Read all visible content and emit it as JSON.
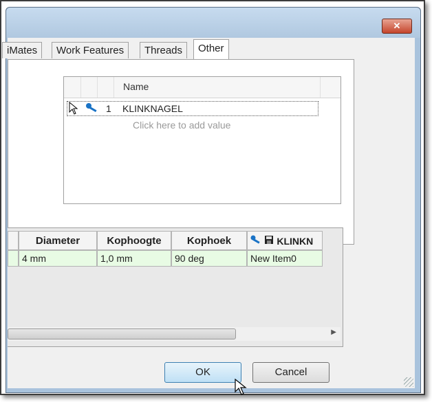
{
  "window": {
    "close_glyph": "✕"
  },
  "tabs": [
    {
      "label": "iMates",
      "active": false
    },
    {
      "label": "Work Features",
      "active": false
    },
    {
      "label": "Threads",
      "active": false
    },
    {
      "label": "Other",
      "active": true
    }
  ],
  "list": {
    "column_header": "Name",
    "rows": [
      {
        "number": "1",
        "name": "KLINKNAGEL",
        "icon": "key-icon"
      }
    ],
    "add_value_hint": "Click here to add value"
  },
  "grid": {
    "headers": [
      "Diameter",
      "Kophoogte",
      "Kophoek",
      "KLINKN"
    ],
    "row": [
      "4 mm",
      "1,0 mm",
      "90 deg",
      "New Item0"
    ],
    "last_header_icons": [
      "key-icon",
      "save-icon"
    ]
  },
  "buttons": {
    "ok": "OK",
    "cancel": "Cancel"
  },
  "colors": {
    "title_bar": "#b0c8e0",
    "close_button": "#c5452c",
    "grid_row": "#e8fbe4",
    "ok_button": "#bfe0f5",
    "key_icon": "#1a73c6"
  }
}
